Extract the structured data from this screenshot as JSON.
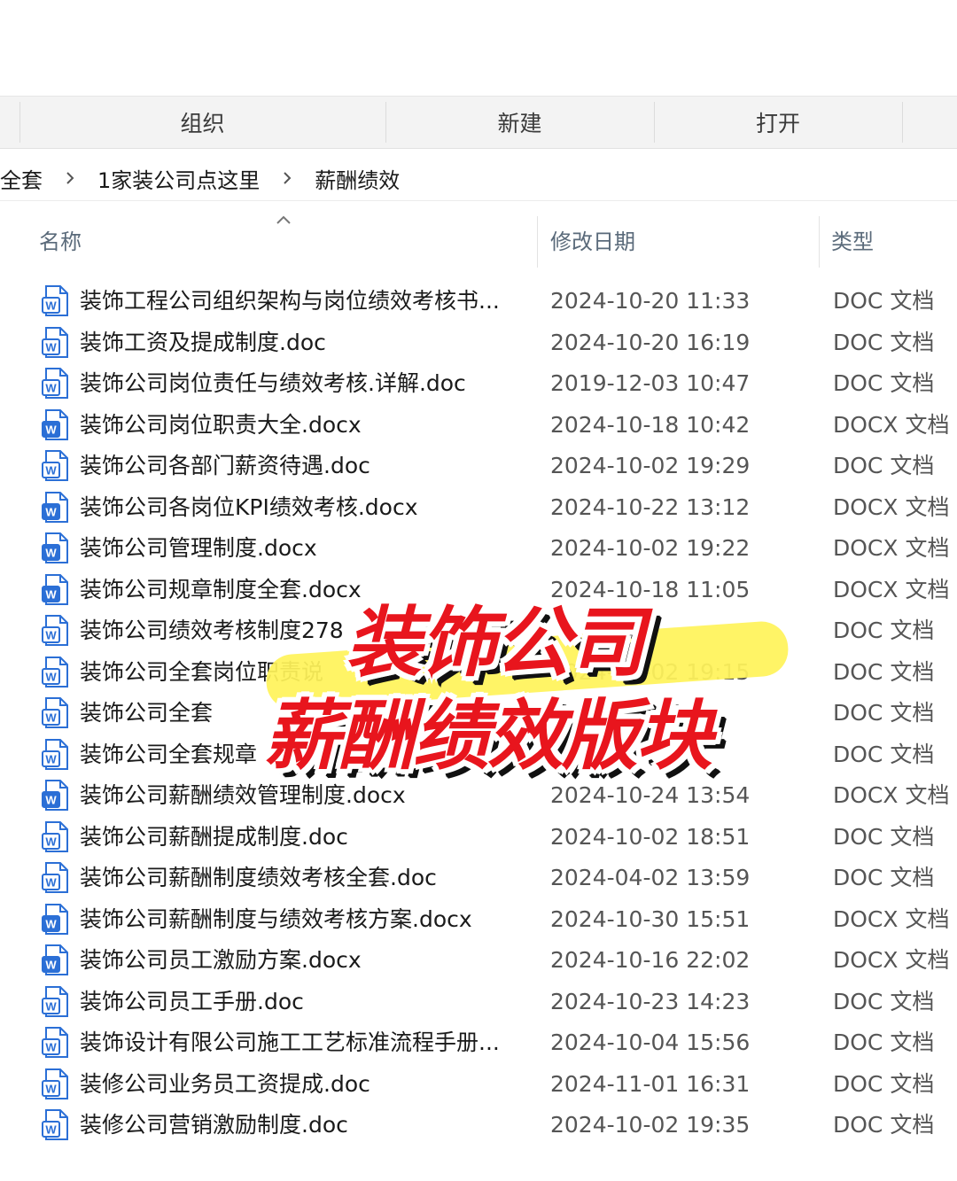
{
  "toolbar": {
    "organize_label": "组织",
    "new_label": "新建",
    "open_label": "打开"
  },
  "breadcrumb": {
    "items": [
      "全套",
      "1家装公司点这里",
      "薪酬绩效"
    ]
  },
  "columns": {
    "name": "名称",
    "date": "修改日期",
    "type": "类型"
  },
  "files": [
    {
      "name": "装饰工程公司组织架构与岗位绩效考核书...",
      "date": "2024-10-20 11:33",
      "type": "DOC 文档",
      "icon": "word-doc-icon"
    },
    {
      "name": "装饰工资及提成制度.doc",
      "date": "2024-10-20 16:19",
      "type": "DOC 文档",
      "icon": "word-doc-icon"
    },
    {
      "name": "装饰公司岗位责任与绩效考核.详解.doc",
      "date": "2019-12-03 10:47",
      "type": "DOC 文档",
      "icon": "word-doc-icon"
    },
    {
      "name": "装饰公司岗位职责大全.docx",
      "date": "2024-10-18 10:42",
      "type": "DOCX 文档",
      "icon": "word-docx-icon"
    },
    {
      "name": "装饰公司各部门薪资待遇.doc",
      "date": "2024-10-02 19:29",
      "type": "DOC 文档",
      "icon": "word-doc-icon"
    },
    {
      "name": "装饰公司各岗位KPI绩效考核.docx",
      "date": "2024-10-22 13:12",
      "type": "DOCX 文档",
      "icon": "word-docx-icon"
    },
    {
      "name": "装饰公司管理制度.docx",
      "date": "2024-10-02 19:22",
      "type": "DOCX 文档",
      "icon": "word-docx-icon"
    },
    {
      "name": "装饰公司规章制度全套.docx",
      "date": "2024-10-18 11:05",
      "type": "DOCX 文档",
      "icon": "word-docx-icon"
    },
    {
      "name": "装饰公司绩效考核制度278",
      "date": "",
      "type": "DOC 文档",
      "icon": "word-doc-icon"
    },
    {
      "name": "装饰公司全套岗位职责说",
      "date": "2024-10-02 19:15",
      "type": "DOC 文档",
      "icon": "word-doc-icon"
    },
    {
      "name": "装饰公司全套",
      "date": "",
      "type": "DOC 文档",
      "icon": "word-doc-icon"
    },
    {
      "name": "装饰公司全套规章",
      "date": "",
      "type": "DOC 文档",
      "icon": "word-doc-icon"
    },
    {
      "name": "装饰公司薪酬绩效管理制度.docx",
      "date": "2024-10-24 13:54",
      "type": "DOCX 文档",
      "icon": "word-docx-icon"
    },
    {
      "name": "装饰公司薪酬提成制度.doc",
      "date": "2024-10-02 18:51",
      "type": "DOC 文档",
      "icon": "word-doc-icon"
    },
    {
      "name": "装饰公司薪酬制度绩效考核全套.doc",
      "date": "2024-04-02 13:59",
      "type": "DOC 文档",
      "icon": "word-doc-icon"
    },
    {
      "name": "装饰公司薪酬制度与绩效考核方案.docx",
      "date": "2024-10-30 15:51",
      "type": "DOCX 文档",
      "icon": "word-docx-icon"
    },
    {
      "name": "装饰公司员工激励方案.docx",
      "date": "2024-10-16 22:02",
      "type": "DOCX 文档",
      "icon": "word-docx-icon"
    },
    {
      "name": "装饰公司员工手册.doc",
      "date": "2024-10-23 14:23",
      "type": "DOC 文档",
      "icon": "word-doc-icon"
    },
    {
      "name": "装饰设计有限公司施工工艺标准流程手册...",
      "date": "2024-10-04 15:56",
      "type": "DOC 文档",
      "icon": "word-doc-icon"
    },
    {
      "name": "装修公司业务员工资提成.doc",
      "date": "2024-11-01 16:31",
      "type": "DOC 文档",
      "icon": "word-doc-icon"
    },
    {
      "name": "装修公司营销激励制度.doc",
      "date": "2024-10-02 19:35",
      "type": "DOC 文档",
      "icon": "word-doc-icon"
    }
  ],
  "overlay": {
    "line1": "装饰公司",
    "line2": "薪酬绩效版块"
  },
  "colors": {
    "overlay_text": "#e8151d",
    "highlight": "#fff35a",
    "word_blue": "#2b6fd6"
  }
}
